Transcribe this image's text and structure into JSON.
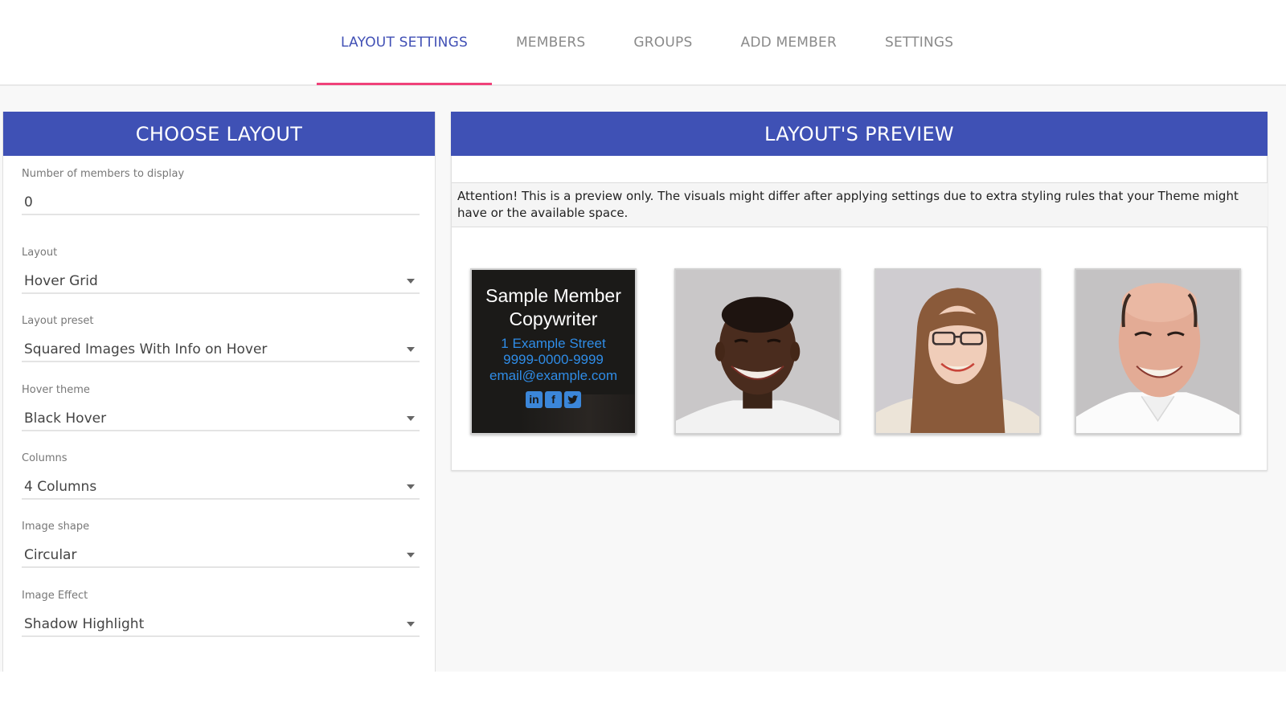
{
  "tabs": [
    {
      "label": "LAYOUT SETTINGS",
      "active": true
    },
    {
      "label": "MEMBERS",
      "active": false
    },
    {
      "label": "GROUPS",
      "active": false
    },
    {
      "label": "ADD MEMBER",
      "active": false
    },
    {
      "label": "SETTINGS",
      "active": false
    }
  ],
  "colors": {
    "accent": "#3f51b5",
    "tab_active_text": "#4150b5",
    "tab_indicator": "#f0427a",
    "hover_bg": "#1b1a18",
    "hover_info": "#2f8ce6"
  },
  "choose_layout": {
    "title": "CHOOSE LAYOUT",
    "fields": [
      {
        "label": "Number of members to display",
        "type": "input",
        "value": "0"
      },
      {
        "label": "Layout",
        "type": "select",
        "value": "Hover Grid"
      },
      {
        "label": "Layout preset",
        "type": "select",
        "value": "Squared Images With Info on Hover"
      },
      {
        "label": "Hover theme",
        "type": "select",
        "value": "Black Hover"
      },
      {
        "label": "Columns",
        "type": "select",
        "value": "4 Columns"
      },
      {
        "label": "Image shape",
        "type": "select",
        "value": "Circular"
      },
      {
        "label": "Image Effect",
        "type": "select",
        "value": "Shadow Highlight"
      }
    ]
  },
  "preview": {
    "title": "LAYOUT'S PREVIEW",
    "notice": "Attention! This is a preview only. The visuals might differ after applying settings due to extra styling rules that your Theme might have or the available space.",
    "hover_member": {
      "name": "Sample Member",
      "role": "Copywriter",
      "address": "1 Example Street",
      "phone": "9999-0000-9999",
      "email": "email@example.com",
      "socials": [
        {
          "icon": "linkedin-icon",
          "glyph": "in"
        },
        {
          "icon": "facebook-icon",
          "glyph": "f"
        },
        {
          "icon": "twitter-icon",
          "glyph": "t"
        }
      ]
    },
    "members": [
      {
        "photo": "man-smiling-white-tshirt"
      },
      {
        "photo": "woman-glasses-long-hair"
      },
      {
        "photo": "bald-man-white-shirt"
      }
    ]
  }
}
